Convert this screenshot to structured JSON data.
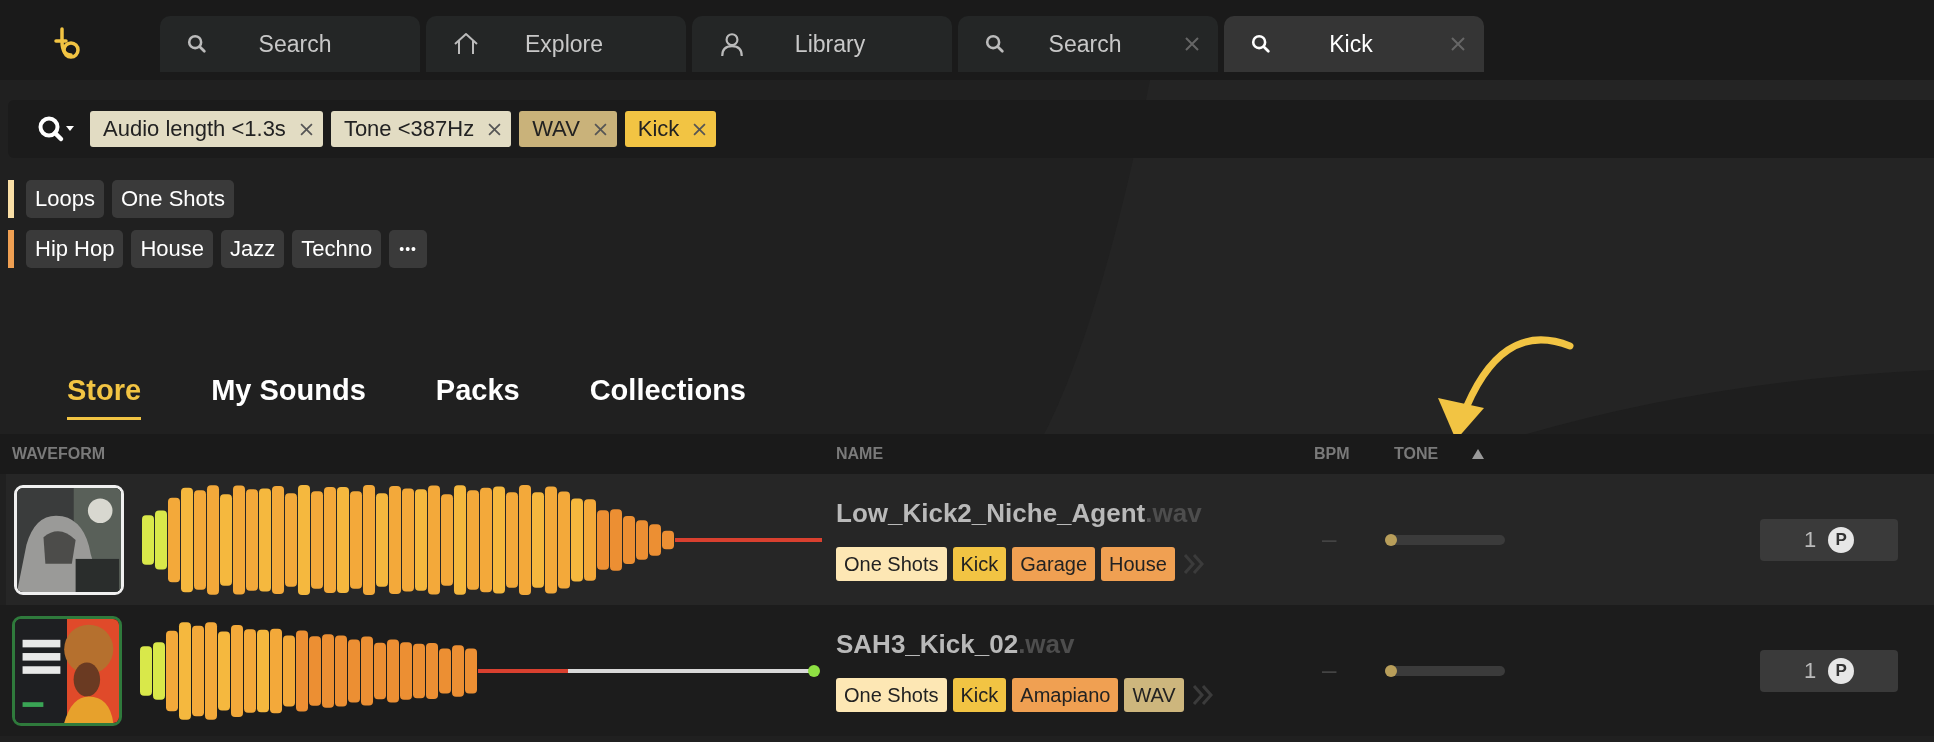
{
  "top_tabs": [
    {
      "kind": "search",
      "label": "Search",
      "closable": false,
      "selected": false
    },
    {
      "kind": "home",
      "label": "Explore",
      "closable": false,
      "selected": false
    },
    {
      "kind": "user",
      "label": "Library",
      "closable": false,
      "selected": false
    },
    {
      "kind": "search",
      "label": "Search",
      "closable": true,
      "selected": false
    },
    {
      "kind": "search",
      "label": "Kick",
      "closable": true,
      "selected": true
    }
  ],
  "filters": [
    {
      "label": "Audio length <1.3s",
      "color": "#e2dcc3"
    },
    {
      "label": "Tone <387Hz",
      "color": "#e2dcc3"
    },
    {
      "label": "WAV",
      "color": "#c9b27a"
    },
    {
      "label": "Kick",
      "color": "#f2c443"
    }
  ],
  "category_groups": [
    {
      "color": "#f9dfa6",
      "tags": [
        "Loops",
        "One Shots"
      ]
    },
    {
      "color": "#ef9f52",
      "tags": [
        "Hip Hop",
        "House",
        "Jazz",
        "Techno"
      ],
      "more": "•••"
    }
  ],
  "content_tabs": [
    {
      "label": "Store",
      "selected": true
    },
    {
      "label": "My Sounds",
      "selected": false
    },
    {
      "label": "Packs",
      "selected": false
    },
    {
      "label": "Collections",
      "selected": false
    }
  ],
  "table": {
    "columns": [
      "WAVEFORM",
      "NAME",
      "BPM",
      "TONE"
    ],
    "rows": [
      {
        "name": "Low_Kick2_Niche_Agent",
        "extension": ".wav",
        "bpm": "–",
        "tone": {
          "level": 0.02
        },
        "price": "1",
        "currency": "P",
        "selected": true,
        "tags": [
          {
            "label": "One Shots",
            "color": "#fde7b4"
          },
          {
            "label": "Kick",
            "color": "#f2c443"
          },
          {
            "label": "Garage",
            "color": "#f0a052"
          },
          {
            "label": "House",
            "color": "#f0a052"
          }
        ]
      },
      {
        "name": "SAH3_Kick_02",
        "extension": ".wav",
        "bpm": "–",
        "tone": {
          "level": 0.02
        },
        "price": "1",
        "currency": "P",
        "selected": false,
        "tags": [
          {
            "label": "One Shots",
            "color": "#fde7b4"
          },
          {
            "label": "Kick",
            "color": "#f2c443"
          },
          {
            "label": "Amapiano",
            "color": "#f0a052"
          },
          {
            "label": "WAV",
            "color": "#cdb67d"
          }
        ]
      }
    ]
  }
}
